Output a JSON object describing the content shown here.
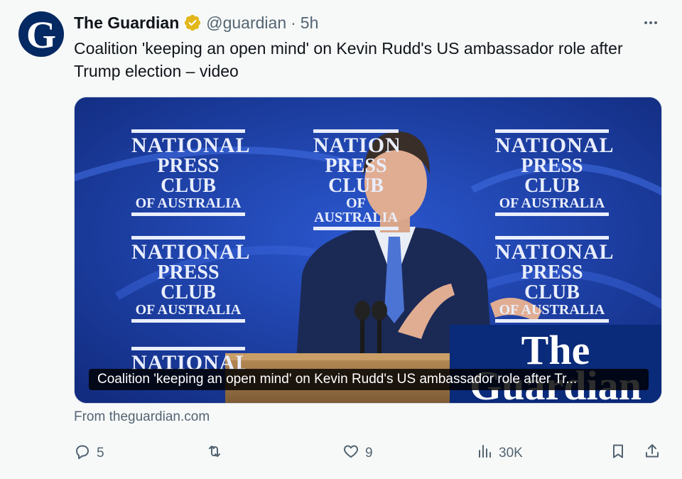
{
  "tweet": {
    "display_name": "The Guardian",
    "handle": "@guardian",
    "separator": "·",
    "time": "5h",
    "avatar_letter": "G",
    "text": "Coalition 'keeping an open mind' on Kevin Rudd's US ambassador role after Trump election – video"
  },
  "media": {
    "caption": "Coalition 'keeping an open mind' on Kevin Rudd's US ambassador role after Tr...",
    "backdrop_logo_lines": [
      "NATIONAL",
      "PRESS CLUB",
      "OF AUSTRALIA"
    ],
    "watermark_lines": [
      "The",
      "Guardian"
    ]
  },
  "source": "From theguardian.com",
  "actions": {
    "reply_count": "5",
    "retweet_count": "",
    "like_count": "9",
    "views_count": "30K"
  },
  "icons": {
    "verified": "verified-badge-icon",
    "more": "more-options-icon",
    "reply": "reply-icon",
    "retweet": "retweet-icon",
    "like": "like-icon",
    "views": "views-icon",
    "bookmark": "bookmark-icon",
    "share": "share-icon"
  },
  "colors": {
    "background": "#f7f9f9",
    "text": "#0f1419",
    "secondary": "#536471",
    "verified_gold": "#e2b719",
    "guardian_blue": "#052962",
    "backdrop_blue": "#1a3d9e"
  }
}
